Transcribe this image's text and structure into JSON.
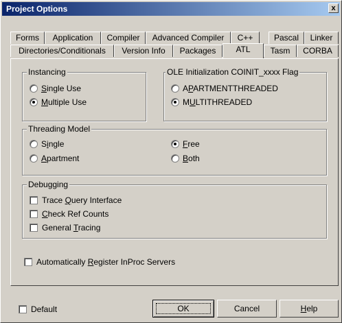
{
  "window": {
    "title": "Project Options",
    "close_glyph": "x"
  },
  "tabs_row1": [
    "Forms",
    "Application",
    "Compiler",
    "Advanced Compiler",
    "C++",
    "Pascal",
    "Linker"
  ],
  "tabs_row2": [
    "Directories/Conditionals",
    "Version Info",
    "Packages",
    "ATL",
    "Tasm",
    "CORBA"
  ],
  "active_tab": "ATL",
  "instancing": {
    "label": "Instancing",
    "options": [
      {
        "pre": "",
        "key": "S",
        "post": "ingle Use",
        "selected": false
      },
      {
        "pre": "",
        "key": "M",
        "post": "ultiple Use",
        "selected": true
      }
    ]
  },
  "ole": {
    "label": "OLE Initialization COINIT_xxxx Flag",
    "options": [
      {
        "pre": "A",
        "key": "P",
        "post": "ARTMENTTHREADED",
        "selected": false
      },
      {
        "pre": "M",
        "key": "U",
        "post": "LTITHREADED",
        "selected": true
      }
    ]
  },
  "threading": {
    "label": "Threading Model",
    "options": [
      {
        "pre": "S",
        "key": "i",
        "post": "ngle",
        "selected": false
      },
      {
        "pre": "",
        "key": "A",
        "post": "partment",
        "selected": false
      },
      {
        "pre": "",
        "key": "F",
        "post": "ree",
        "selected": true
      },
      {
        "pre": "",
        "key": "B",
        "post": "oth",
        "selected": false
      }
    ]
  },
  "debugging": {
    "label": "Debugging",
    "options": [
      {
        "pre": "Trace ",
        "key": "Q",
        "post": "uery Interface",
        "checked": false
      },
      {
        "pre": "",
        "key": "C",
        "post": "heck Ref Counts",
        "checked": false
      },
      {
        "pre": "General ",
        "key": "T",
        "post": "racing",
        "checked": false
      }
    ]
  },
  "auto_register": {
    "pre": "Automatically ",
    "key": "R",
    "post": "egister InProc Servers",
    "checked": false
  },
  "footer": {
    "default_label": "Default",
    "default_checked": false,
    "ok_label": "OK",
    "cancel_label": "Cancel",
    "help_pre": "",
    "help_key": "H",
    "help_post": "elp"
  },
  "colors": {
    "title_start": "#0a246a",
    "title_end": "#a6caf0",
    "face": "#d4d0c8"
  }
}
